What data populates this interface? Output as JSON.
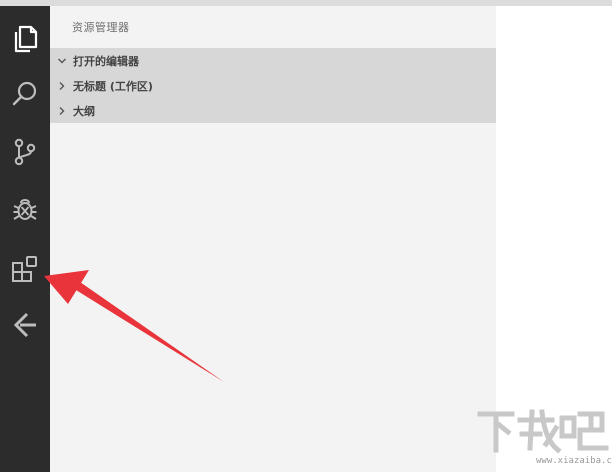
{
  "sidebar": {
    "title": "资源管理器",
    "sections": [
      {
        "label": "打开的编辑器",
        "expanded": true
      },
      {
        "label": "无标题 (工作区)",
        "expanded": false
      },
      {
        "label": "大纲",
        "expanded": false
      }
    ]
  },
  "activity_bar": {
    "items": [
      {
        "icon": "files-icon"
      },
      {
        "icon": "search-icon"
      },
      {
        "icon": "source-control-icon"
      },
      {
        "icon": "debug-icon"
      },
      {
        "icon": "extensions-icon"
      },
      {
        "icon": "remote-icon"
      }
    ]
  },
  "watermark": {
    "url": "www.xiazaiba.com"
  },
  "colors": {
    "activity_bar": "#2c2c2c",
    "sidebar_bg": "#f3f3f3",
    "section_bg": "#d7d7d7",
    "arrow": "#e8343a"
  }
}
